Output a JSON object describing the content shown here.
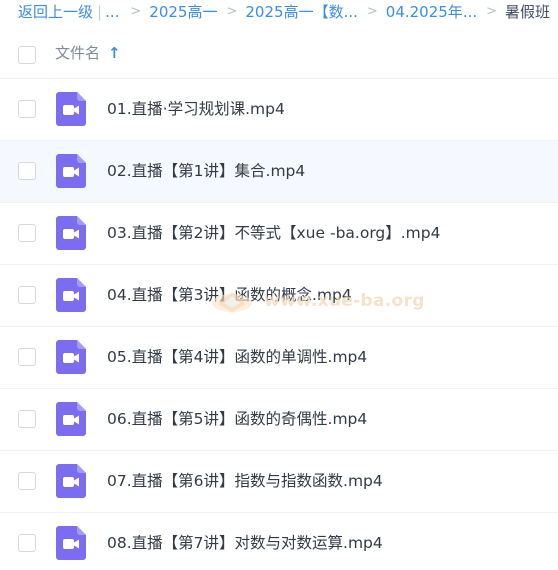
{
  "breadcrumb": {
    "back": "返回上一级",
    "separator": "|",
    "ellipsis": "...",
    "arrow": ">",
    "crumbs": [
      "2025高一",
      "2025高一【数...",
      "04.2025年..."
    ],
    "current": "暑假班"
  },
  "header": {
    "column_name": "文件名",
    "sort_icon": "arrow-up-icon",
    "sort_glyph": "↑"
  },
  "files": [
    {
      "name": "01.直播·学习规划课.mp4",
      "icon": "video-file-icon"
    },
    {
      "name": "02.直播【第1讲】集合.mp4",
      "icon": "video-file-icon"
    },
    {
      "name": "03.直播【第2讲】不等式【xue -ba.org】.mp4",
      "icon": "video-file-icon"
    },
    {
      "name": "04.直播【第3讲】函数的概念.mp4",
      "icon": "video-file-icon"
    },
    {
      "name": "05.直播【第4讲】函数的单调性.mp4",
      "icon": "video-file-icon"
    },
    {
      "name": "06.直播【第5讲】函数的奇偶性.mp4",
      "icon": "video-file-icon"
    },
    {
      "name": "07.直播【第6讲】指数与指数函数.mp4",
      "icon": "video-file-icon"
    },
    {
      "name": "08.直播【第7讲】对数与对数运算.mp4",
      "icon": "video-file-icon"
    }
  ],
  "watermark": {
    "text": "www.xue-ba.org"
  },
  "colors": {
    "accent": "#3a8ee6",
    "video_icon": "#7b6cf0",
    "row_highlight": "#f5f9ff"
  }
}
